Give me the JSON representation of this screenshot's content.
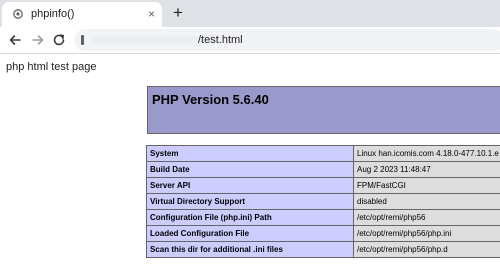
{
  "tab": {
    "title": "phpinfo()",
    "close_glyph": "×",
    "new_tab_glyph": "+"
  },
  "omnibox": {
    "url": "/test.html"
  },
  "page": {
    "heading": "php html test page",
    "php_version": "PHP Version 5.6.40",
    "rows": [
      {
        "key": "System",
        "value": "Linux han.icomis.com 4.18.0-477.10.1.e"
      },
      {
        "key": "Build Date",
        "value": "Aug 2 2023 11:48:47"
      },
      {
        "key": "Server API",
        "value": "FPM/FastCGI"
      },
      {
        "key": "Virtual Directory Support",
        "value": "disabled"
      },
      {
        "key": "Configuration File (php.ini) Path",
        "value": "/etc/opt/remi/php56"
      },
      {
        "key": "Loaded Configuration File",
        "value": "/etc/opt/remi/php56/php.ini"
      },
      {
        "key": "Scan this dir for additional .ini files",
        "value": "/etc/opt/remi/php56/php.d"
      }
    ]
  },
  "icons": {
    "favicon": "globe-icon",
    "back": "back-arrow-icon",
    "forward": "forward-arrow-icon",
    "reload": "reload-icon",
    "site_info": "site-info-icon"
  }
}
